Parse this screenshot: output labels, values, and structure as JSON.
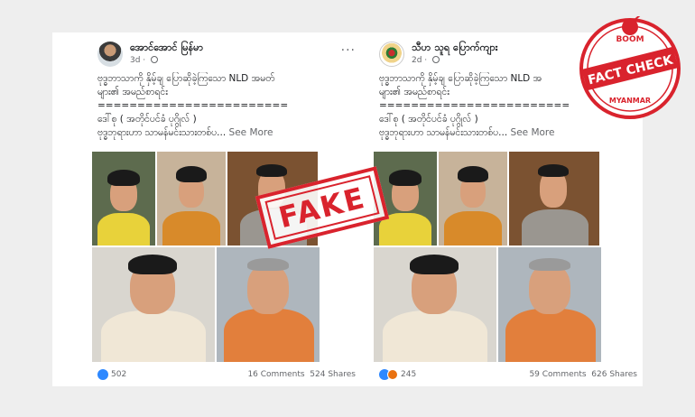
{
  "left_post": {
    "author": "အောင်အောင် မြန်မာ",
    "time": "3d · ",
    "more": "···",
    "lines": [
      "ဗုဒ္ဓဘာသာကို နှိမ့်ချ ပြောဆိုခဲ့ကြသော NLD အမတ်",
      "များ၏ အမည်စာရင်း",
      "========================",
      "ဒေါ်စု ( အတိုင်ပင်ခံ ပုဂ္ဂိုလ် )",
      "ဗုဒ္ဓဘုရားဟာ သာမန်မင်းသားတစ်ပ..."
    ],
    "see_more": "See More",
    "reactions": "502",
    "comments": "16 Comments",
    "shares": "524 Shares"
  },
  "right_post": {
    "author": "သီဟ သူရ ပြောက်ကျား",
    "time": "2d · ",
    "more": "···",
    "lines": [
      "ဗုဒ္ဓဘာသာကို နှိမ့်ချ ပြောဆိုခဲ့ကြသော NLD အ",
      "များ၏ အမည်စာရင်း",
      "========================",
      "ဒေါ်စု ( အတိုင်ပင်ခံ ပုဂ္ဂိုလ် )",
      "ဗုဒ္ဓဘုရားဟာ သာမန်မင်းသားတစ်ပ..."
    ],
    "see_more": "See More",
    "reactions": "245",
    "comments": "59 Comments",
    "shares": "626 Shares"
  },
  "stamp": {
    "fake": "FAKE"
  },
  "badge": {
    "top": "BOOM",
    "middle": "FACT CHECK",
    "bottom": "MYANMAR"
  },
  "colors": {
    "stamp_red": "#d9232d",
    "like_blue": "#2d88ff",
    "angry_orange": "#e9710f"
  }
}
